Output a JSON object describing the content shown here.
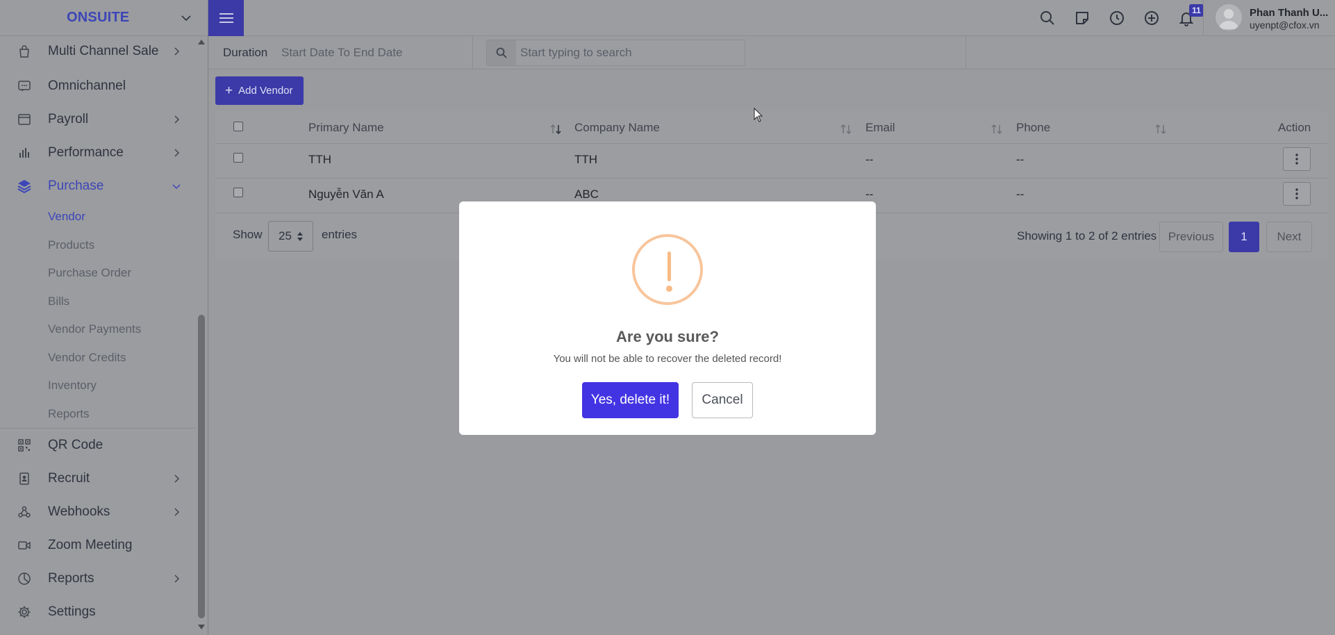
{
  "brand": {
    "name": "ONSUITE"
  },
  "sidebar": {
    "items_top": [
      {
        "label": "Multi Channel Sale",
        "icon": "shopping-bag-icon",
        "has_children": true
      },
      {
        "label": "Omnichannel",
        "icon": "chat-monitor-icon",
        "has_children": false
      },
      {
        "label": "Payroll",
        "icon": "window-icon",
        "has_children": true
      },
      {
        "label": "Performance",
        "icon": "bar-chart-icon",
        "has_children": true
      },
      {
        "label": "Purchase",
        "icon": "layers-icon",
        "has_children": true,
        "expanded": true
      }
    ],
    "purchase_children": [
      "Vendor",
      "Products",
      "Purchase Order",
      "Bills",
      "Vendor Payments",
      "Vendor Credits",
      "Inventory",
      "Reports"
    ],
    "active_child": "Vendor",
    "items_bottom": [
      {
        "label": "QR Code",
        "icon": "qr-code-icon",
        "has_children": false
      },
      {
        "label": "Recruit",
        "icon": "id-badge-icon",
        "has_children": true
      },
      {
        "label": "Webhooks",
        "icon": "webhook-icon",
        "has_children": true
      },
      {
        "label": "Zoom Meeting",
        "icon": "video-camera-icon",
        "has_children": false
      },
      {
        "label": "Reports",
        "icon": "pie-chart-icon",
        "has_children": true
      },
      {
        "label": "Settings",
        "icon": "gear-icon",
        "has_children": false
      }
    ]
  },
  "topbar": {
    "notification_count": "11",
    "user_name": "Phan Thanh U...",
    "user_email": "uyenpt@cfox.vn"
  },
  "filters": {
    "duration_label": "Duration",
    "duration_placeholder": "Start Date To End Date",
    "search_placeholder": "Start typing to search"
  },
  "toolbar": {
    "add_vendor_label": "Add Vendor"
  },
  "table": {
    "columns": [
      "Primary Name",
      "Company Name",
      "Email",
      "Phone",
      "Action"
    ],
    "rows": [
      {
        "primary_name": "TTH",
        "company_name": "TTH",
        "email": "--",
        "phone": "--"
      },
      {
        "primary_name": "Nguyễn Văn A",
        "company_name": "ABC",
        "email": "--",
        "phone": "--"
      }
    ],
    "show_label": "Show",
    "page_size": "25",
    "entries_label": "entries",
    "info": "Showing 1 to 2 of 2 entries",
    "prev_label": "Previous",
    "current_page": "1",
    "next_label": "Next"
  },
  "modal": {
    "title": "Are you sure?",
    "text": "You will not be able to recover the deleted record!",
    "confirm_label": "Yes, delete it!",
    "cancel_label": "Cancel"
  },
  "colors": {
    "primary": "#4334e3",
    "warning": "#f8bb86",
    "backdrop": "#9a9b9e"
  }
}
